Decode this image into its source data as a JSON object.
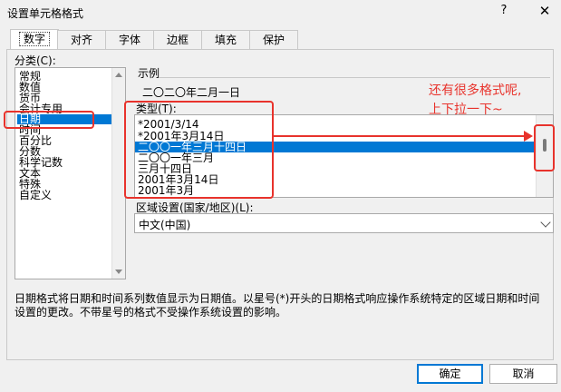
{
  "window": {
    "title": "设置单元格格式",
    "help": "?",
    "close": "✕"
  },
  "tabs": [
    {
      "label": "数字",
      "active": true
    },
    {
      "label": "对齐"
    },
    {
      "label": "字体"
    },
    {
      "label": "边框"
    },
    {
      "label": "填充"
    },
    {
      "label": "保护"
    }
  ],
  "category": {
    "label": "分类(C):",
    "items": [
      "常规",
      "数值",
      "货币",
      "会计专用",
      "日期",
      "时间",
      "百分比",
      "分数",
      "科学记数",
      "文本",
      "特殊",
      "自定义"
    ],
    "selected": "日期"
  },
  "example": {
    "label": "示例",
    "value": "二〇二〇年二月一日"
  },
  "type": {
    "label": "类型(T):",
    "items": [
      "*2001/3/14",
      "*2001年3月14日",
      "二〇〇一年三月十四日",
      "二〇〇一年三月",
      "三月十四日",
      "2001年3月14日",
      "2001年3月"
    ],
    "selected": "二〇〇一年三月十四日"
  },
  "region": {
    "label": "区域设置(国家/地区)(L):",
    "value": "中文(中国)"
  },
  "description": "日期格式将日期和时间系列数值显示为日期值。以星号(*)开头的日期格式响应操作系统特定的区域日期和时间设置的更改。不带星号的格式不受操作系统设置的影响。",
  "buttons": {
    "ok": "确定",
    "cancel": "取消"
  },
  "annotation": {
    "line1": "还有很多格式呢,",
    "line2": "上下拉一下~",
    "color": "#e8332c"
  },
  "colors": {
    "selection": "#0078d4",
    "annotation": "#e8332c"
  }
}
